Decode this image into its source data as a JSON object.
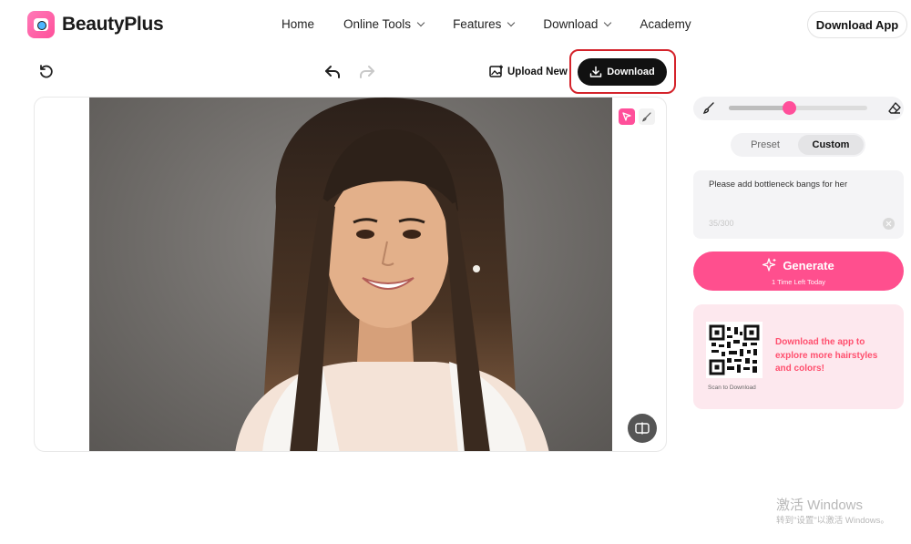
{
  "nav": {
    "brand": "BeautyPlus",
    "menu": [
      {
        "label": "Home",
        "has_dropdown": false
      },
      {
        "label": "Online Tools",
        "has_dropdown": true
      },
      {
        "label": "Features",
        "has_dropdown": true
      },
      {
        "label": "Download",
        "has_dropdown": true
      },
      {
        "label": "Academy",
        "has_dropdown": false
      }
    ],
    "cta": "Download App"
  },
  "toolbar": {
    "upload_label": "Upload New",
    "download_label": "Download",
    "icons": [
      "reset-icon",
      "undo-icon",
      "redo-icon",
      "upload-image-icon",
      "download-icon"
    ]
  },
  "canvas": {
    "tools": [
      "select-pen-icon",
      "brush-icon"
    ],
    "compare_icon": "compare-icon"
  },
  "panel": {
    "brush_size_fraction": 0.44,
    "tabs": [
      {
        "label": "Preset",
        "active": false
      },
      {
        "label": "Custom",
        "active": true
      }
    ],
    "prompt": {
      "value": "Please add bottleneck bangs for her",
      "count": "35/300"
    },
    "generate": {
      "label": "Generate",
      "sub": "1 Time Left Today"
    },
    "promo": {
      "text": "Download the app to explore more hairstyles and colors!",
      "caption": "Scan to Download"
    }
  },
  "watermark": {
    "title": "激活 Windows",
    "sub": "转到\"设置\"以激活 Windows。"
  },
  "colors": {
    "accent": "#ff4f8e",
    "promo_text": "#ff4f6e",
    "highlight": "#d4232b"
  }
}
